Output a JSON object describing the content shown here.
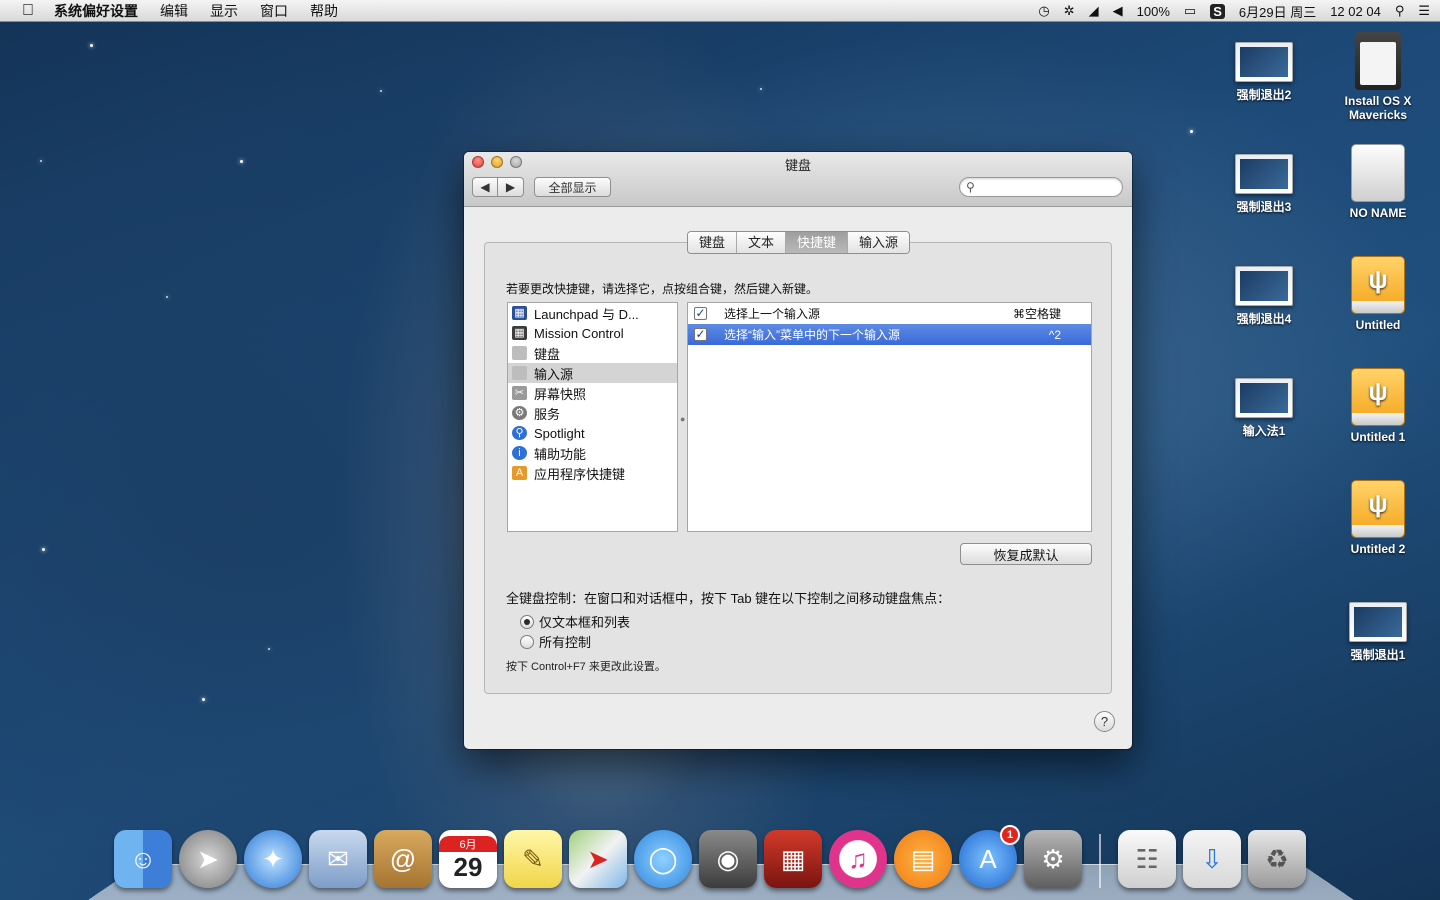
{
  "menubar": {
    "app_name": "系统偏好设置",
    "items": [
      "编辑",
      "显示",
      "窗口",
      "帮助"
    ],
    "battery": "100%",
    "date": "6月29日 周三",
    "time": "12 02 04"
  },
  "window": {
    "title": "键盘",
    "show_all": "全部显示",
    "search_placeholder": "",
    "tabs": [
      {
        "label": "键盘",
        "active": false
      },
      {
        "label": "文本",
        "active": false
      },
      {
        "label": "快捷键",
        "active": true
      },
      {
        "label": "输入源",
        "active": false
      }
    ],
    "instruction": "若要更改快捷键，请选择它，点按组合键，然后键入新键。",
    "categories": [
      {
        "label": "Launchpad 与 D...",
        "icon": "launchpad-icon",
        "color": "#2b4f9a"
      },
      {
        "label": "Mission Control",
        "icon": "mission-control-icon",
        "color": "#3c3c3c"
      },
      {
        "label": "键盘",
        "icon": "keyboard-icon",
        "color": "#bdbdbd"
      },
      {
        "label": "输入源",
        "icon": "input-source-icon",
        "color": "#bdbdbd",
        "selected": true
      },
      {
        "label": "屏幕快照",
        "icon": "screenshot-icon",
        "color": "#9a9a9a"
      },
      {
        "label": "服务",
        "icon": "gear-icon",
        "color": "#7a7a7a"
      },
      {
        "label": "Spotlight",
        "icon": "spotlight-icon",
        "color": "#2f6fd6"
      },
      {
        "label": "辅助功能",
        "icon": "accessibility-icon",
        "color": "#2f6fd6"
      },
      {
        "label": "应用程序快捷键",
        "icon": "app-shortcuts-icon",
        "color": "#e59a2a"
      }
    ],
    "shortcuts": [
      {
        "label": "选择上一个输入源",
        "key": "⌘空格键",
        "checked": true,
        "selected": false
      },
      {
        "label": "选择“输入”菜单中的下一个输入源",
        "key": "^2",
        "checked": true,
        "selected": true
      }
    ],
    "restore_button": "恢复成默认",
    "full_keyboard_control": "全键盘控制：在窗口和对话框中，按下 Tab 键在以下控制之间移动键盘焦点：",
    "radio_options": [
      {
        "label": "仅文本框和列表",
        "checked": true
      },
      {
        "label": "所有控制",
        "checked": false
      }
    ],
    "hint": "按下 Control+F7 来更改此设置。",
    "help": "?"
  },
  "desktop_icons": [
    {
      "label": "强制退出2",
      "kind": "screen"
    },
    {
      "label": "Install OS X Mavericks",
      "kind": "sd"
    },
    {
      "label": "强制退出3",
      "kind": "screen"
    },
    {
      "label": "NO NAME",
      "kind": "drive"
    },
    {
      "label": "强制退出4",
      "kind": "screen"
    },
    {
      "label": "Untitled",
      "kind": "usb"
    },
    {
      "label": "输入法1",
      "kind": "screen"
    },
    {
      "label": "Untitled 1",
      "kind": "usb"
    },
    {
      "label": "Untitled 2",
      "kind": "usb"
    },
    {
      "label": "强制退出1",
      "kind": "screen"
    }
  ],
  "dock": {
    "calendar_month": "6月",
    "calendar_day": "29",
    "app_store_badge": "1"
  }
}
